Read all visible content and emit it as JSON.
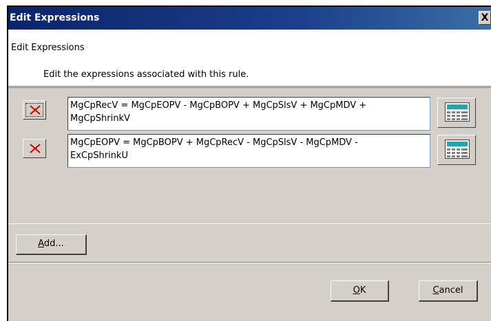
{
  "window": {
    "title": "Edit Expressions",
    "close_glyph": "X"
  },
  "header": {
    "title": "Edit Expressions",
    "description": "Edit the expressions associated with this rule."
  },
  "expressions": [
    {
      "text": "MgCpRecV = MgCpEOPV - MgCpBOPV + MgCpSlsV + MgCpMDV +\nMgCpShrinkV",
      "delete_icon": "delete-x-icon",
      "calc_icon": "calculator-icon"
    },
    {
      "text": "MgCpEOPV = MgCpBOPV + MgCpRecV - MgCpSlsV - MgCpMDV -\nExCpShrinkU",
      "delete_icon": "delete-x-icon",
      "calc_icon": "calculator-icon"
    }
  ],
  "buttons": {
    "add_mnemonic": "A",
    "add_rest": "dd...",
    "ok_mnemonic": "O",
    "ok_rest": "K",
    "cancel_mnemonic": "C",
    "cancel_rest": "ancel"
  },
  "colors": {
    "titlebar": "#0a246a",
    "dialog_bg": "#d4d0c8",
    "delete_red": "#cc0000",
    "calc_teal": "#2aa0a8"
  }
}
